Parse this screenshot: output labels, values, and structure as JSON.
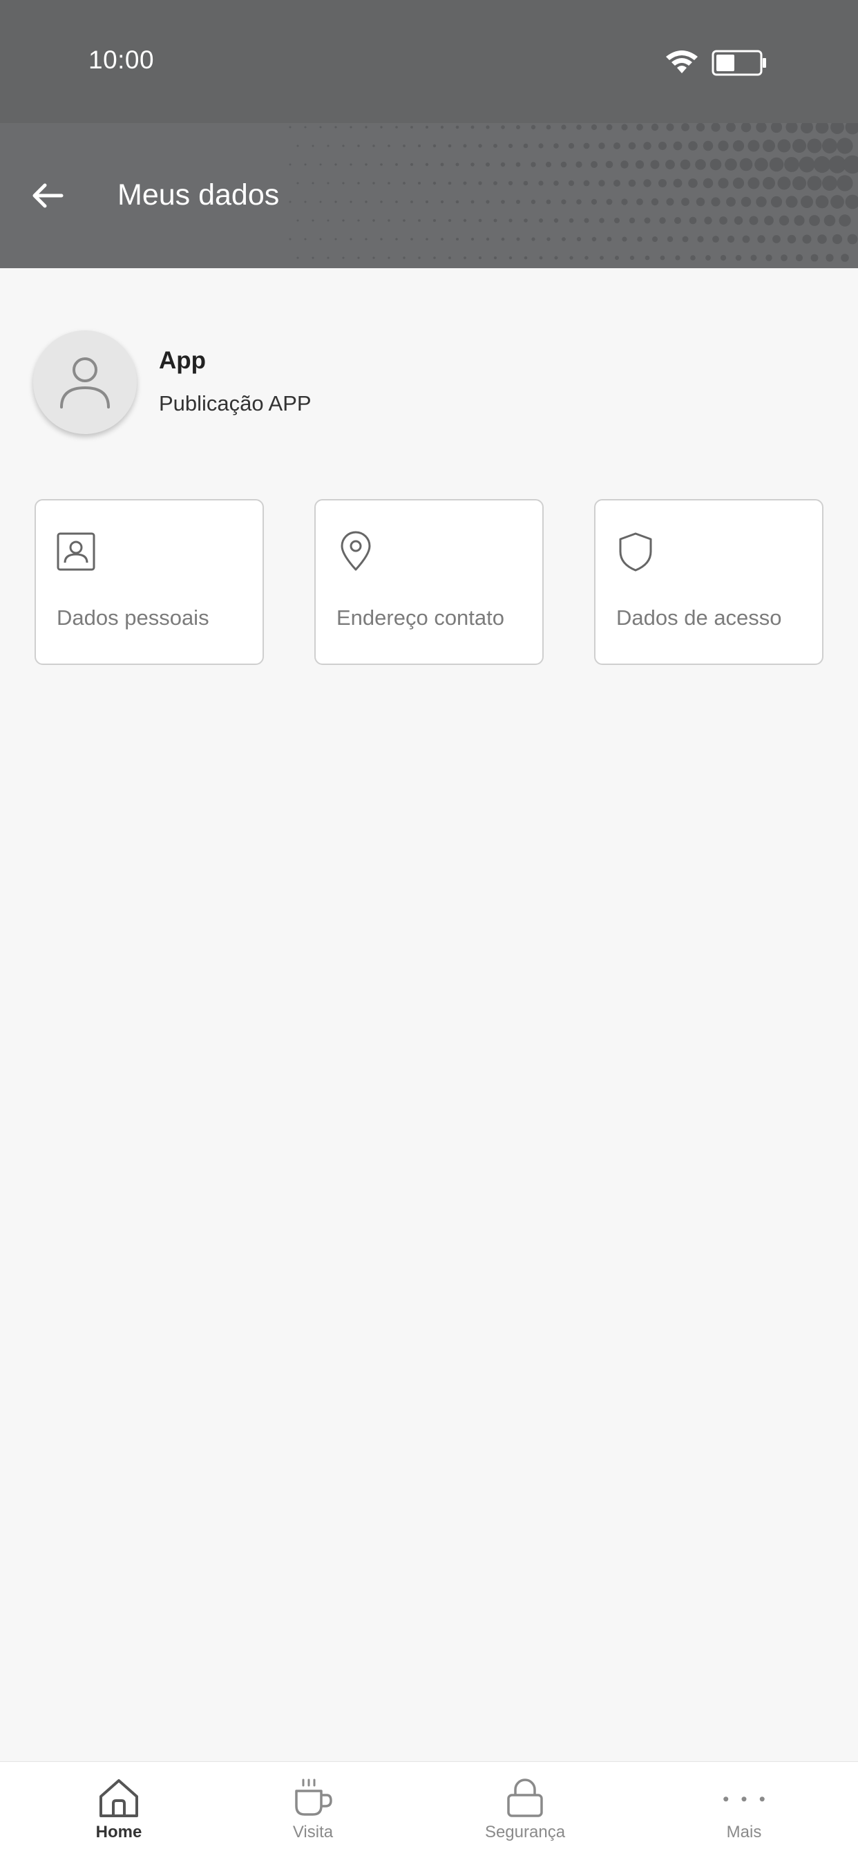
{
  "status_bar": {
    "time": "10:00",
    "icons": [
      "wifi-icon",
      "battery-icon"
    ]
  },
  "header": {
    "title": "Meus dados",
    "back_icon": "arrow-left-icon",
    "background_color": "#6b6c6e"
  },
  "profile": {
    "avatar_icon": "user-icon",
    "name": "App",
    "subtitle": "Publicação APP"
  },
  "cards": [
    {
      "label": "Dados pessoais",
      "icon": "id-card-icon"
    },
    {
      "label": "Endereço contato",
      "icon": "location-pin-icon"
    },
    {
      "label": "Dados de acesso",
      "icon": "shield-icon"
    }
  ],
  "bottom_nav": {
    "items": [
      {
        "label": "Home",
        "icon": "home-icon",
        "active": true
      },
      {
        "label": "Visita",
        "icon": "coffee-cup-icon",
        "active": false
      },
      {
        "label": "Segurança",
        "icon": "lock-icon",
        "active": false
      },
      {
        "label": "Mais",
        "icon": "more-dots-icon",
        "active": false
      }
    ]
  },
  "colors": {
    "status_bar": "#646566",
    "content_background": "#f7f7f7",
    "card_border": "#cfcfcf",
    "muted_text": "#7b7b7b"
  }
}
